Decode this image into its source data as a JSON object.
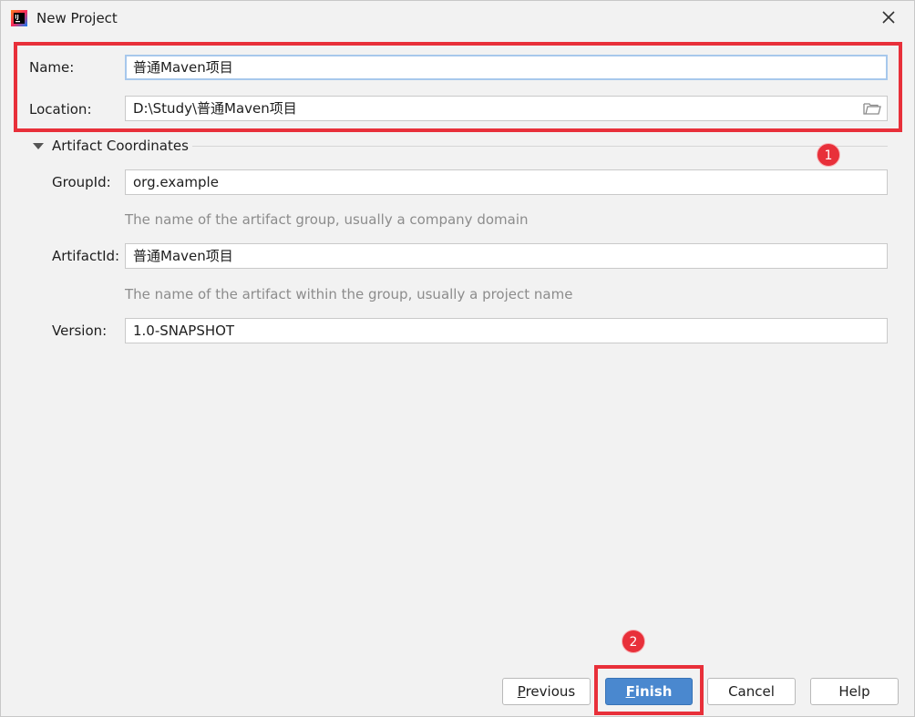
{
  "window": {
    "title": "New Project"
  },
  "form": {
    "name_label": "Name:",
    "name_value": "普通Maven项目",
    "location_label": "Location:",
    "location_value": "D:\\Study\\普通Maven项目"
  },
  "artifact": {
    "section_title": "Artifact Coordinates",
    "group_label": "GroupId:",
    "group_value": "org.example",
    "group_hint": "The name of the artifact group, usually a company domain",
    "artifact_label": "ArtifactId:",
    "artifact_value": "普通Maven项目",
    "artifact_hint": "The name of the artifact within the group, usually a project name",
    "version_label": "Version:",
    "version_value": "1.0-SNAPSHOT"
  },
  "annotations": {
    "badge_1": "1",
    "badge_2": "2"
  },
  "buttons": {
    "previous": "Previous",
    "finish": "Finish",
    "cancel": "Cancel",
    "help": "Help"
  },
  "icons": [
    "intellij-app-icon",
    "close-icon",
    "folder-icon",
    "triangle-down-icon"
  ],
  "colors": {
    "highlight": "#e8303a",
    "primary": "#4a88cf",
    "focus": "#a7c8ec"
  }
}
